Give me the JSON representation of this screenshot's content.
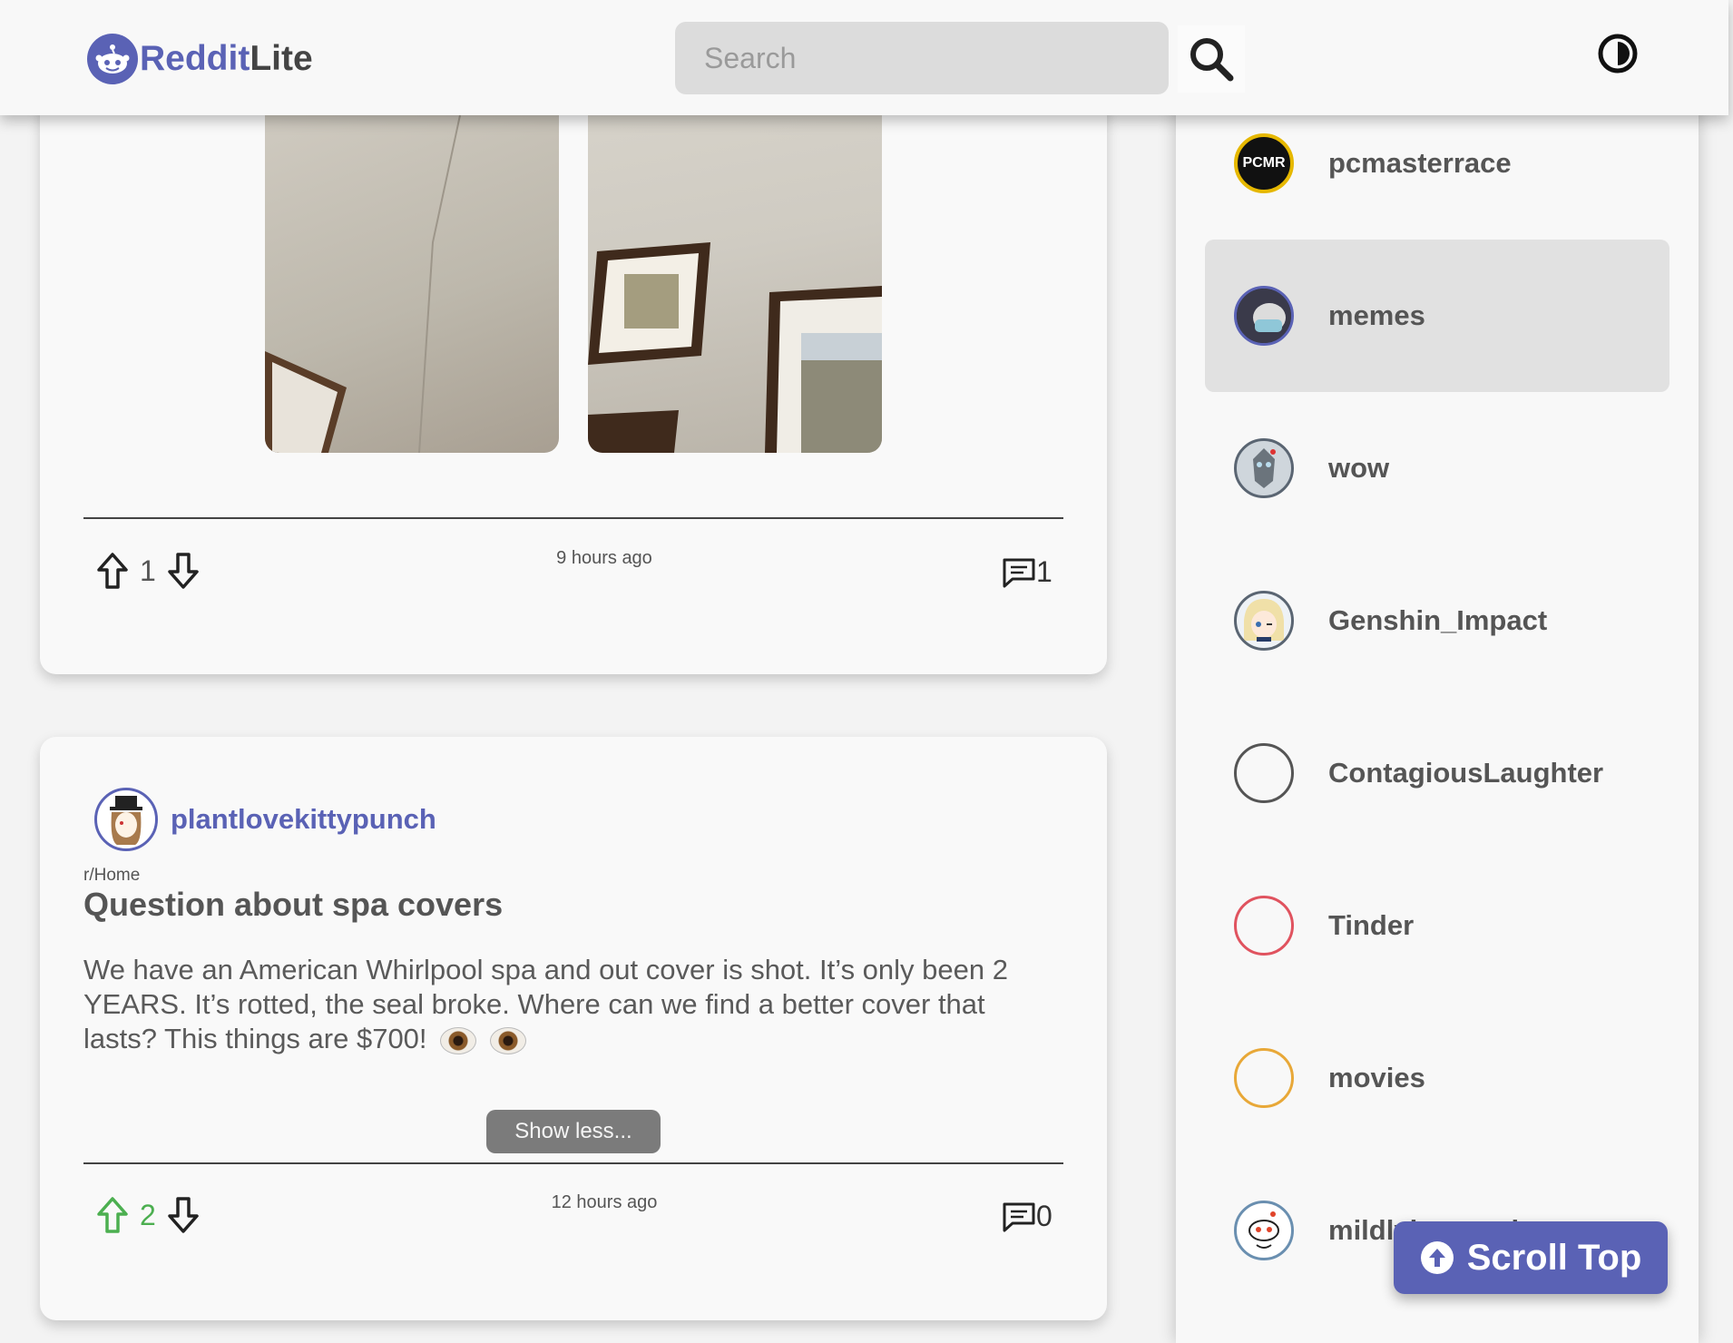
{
  "header": {
    "logo_part1": "Reddit",
    "logo_part2": "Lite",
    "search_placeholder": "Search",
    "search_icon": "search-icon",
    "theme_icon": "theme-toggle-icon"
  },
  "posts": [
    {
      "votes": "1",
      "time": "9 hours ago",
      "comments": "1",
      "images": [
        "gallery-image-1",
        "gallery-image-2"
      ]
    },
    {
      "author": "plantlovekittypunch",
      "subreddit": "r/Home",
      "title": "Question about spa covers",
      "body": "We have an American Whirlpool spa and out cover is shot. It’s only been 2 YEARS. It’s rotted, the seal broke. Where can we find a better cover that lasts? This things are $700!",
      "show_less_label": "Show less...",
      "votes": "2",
      "time": "12 hours ago",
      "comments": "0",
      "upvoted_color": "#4caf50"
    }
  ],
  "sidebar": {
    "items": [
      {
        "label": "pcmasterrace",
        "avatar_text": "PCMR"
      },
      {
        "label": "memes",
        "active": true
      },
      {
        "label": "wow"
      },
      {
        "label": "Genshin_Impact"
      },
      {
        "label": "ContagiousLaughter",
        "ring_color": "#555555"
      },
      {
        "label": "Tinder",
        "ring_color": "#e0535f"
      },
      {
        "label": "movies",
        "ring_color": "#e8a838"
      },
      {
        "label": "mildlyinteresting"
      }
    ]
  },
  "scroll_top_label": "Scroll Top",
  "colors": {
    "accent": "#5a62b5",
    "upvote_green": "#4caf50",
    "background": "#f3f3f3"
  }
}
